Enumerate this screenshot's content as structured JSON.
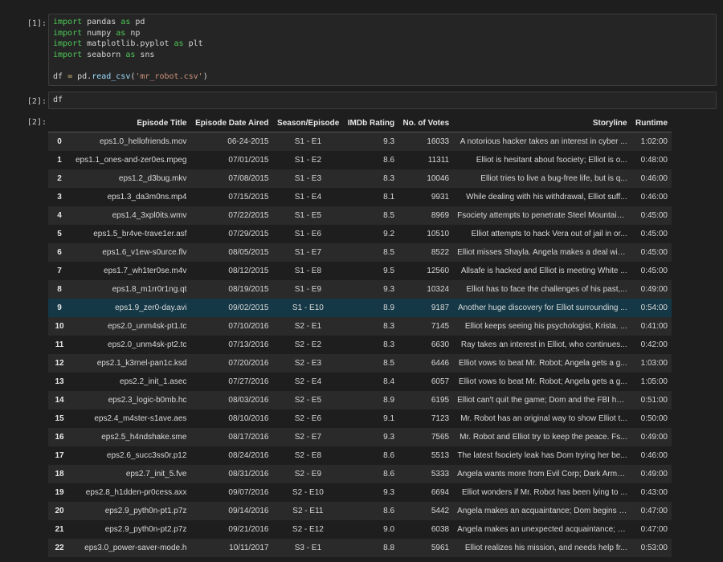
{
  "cells": [
    {
      "prompt": "[1]:",
      "code": [
        [
          {
            "t": "import",
            "c": "kw"
          },
          {
            "t": " pandas ",
            "c": "mod"
          },
          {
            "t": "as",
            "c": "kw"
          },
          {
            "t": " pd",
            "c": "id"
          }
        ],
        [
          {
            "t": "import",
            "c": "kw"
          },
          {
            "t": " numpy ",
            "c": "mod"
          },
          {
            "t": "as",
            "c": "kw"
          },
          {
            "t": " np",
            "c": "id"
          }
        ],
        [
          {
            "t": "import",
            "c": "kw"
          },
          {
            "t": " matplotlib.pyplot ",
            "c": "mod"
          },
          {
            "t": "as",
            "c": "kw"
          },
          {
            "t": " plt",
            "c": "id"
          }
        ],
        [
          {
            "t": "import",
            "c": "kw"
          },
          {
            "t": " seaborn ",
            "c": "mod"
          },
          {
            "t": "as",
            "c": "kw"
          },
          {
            "t": " sns",
            "c": "id"
          }
        ],
        [],
        [
          {
            "t": "df ",
            "c": "id"
          },
          {
            "t": "=",
            "c": "op"
          },
          {
            "t": " pd.",
            "c": "id"
          },
          {
            "t": "read_csv",
            "c": "fn"
          },
          {
            "t": "(",
            "c": "id"
          },
          {
            "t": "'mr_robot.csv'",
            "c": "str"
          },
          {
            "t": ")",
            "c": "id"
          }
        ]
      ]
    },
    {
      "prompt": "[2]:",
      "code": [
        [
          {
            "t": "df",
            "c": "id"
          }
        ]
      ]
    }
  ],
  "output": {
    "prompt": "[2]:",
    "columns": [
      "",
      "Episode Title",
      "Episode Date Aired",
      "Season/Episode",
      "IMDb Rating",
      "No. of Votes",
      "Storyline",
      "Runtime"
    ],
    "selected_row": 9,
    "rows": [
      [
        "0",
        "eps1.0_hellofriends.mov",
        "06-24-2015",
        "S1 - E1",
        "9.3",
        "16033",
        "A notorious hacker takes an interest in cyber ...",
        "1:02:00"
      ],
      [
        "1",
        "eps1.1_ones-and-zer0es.mpeg",
        "07/01/2015",
        "S1 - E2",
        "8.6",
        "11311",
        "Elliot is hesitant about fsociety; Elliot is o...",
        "0:48:00"
      ],
      [
        "2",
        "eps1.2_d3bug.mkv",
        "07/08/2015",
        "S1 - E3",
        "8.3",
        "10046",
        "Elliot tries to live a bug-free life, but is q...",
        "0:46:00"
      ],
      [
        "3",
        "eps1.3_da3m0ns.mp4",
        "07/15/2015",
        "S1 - E4",
        "8.1",
        "9931",
        "While dealing with his withdrawal, Elliot suff...",
        "0:46:00"
      ],
      [
        "4",
        "eps1.4_3xpl0its.wmv",
        "07/22/2015",
        "S1 - E5",
        "8.5",
        "8969",
        "Fsociety attempts to penetrate Steel Mountain,...",
        "0:45:00"
      ],
      [
        "5",
        "eps1.5_br4ve-trave1er.asf",
        "07/29/2015",
        "S1 - E6",
        "9.2",
        "10510",
        "Elliot attempts to hack Vera out of jail in or...",
        "0:45:00"
      ],
      [
        "6",
        "eps1.6_v1ew-s0urce.flv",
        "08/05/2015",
        "S1 - E7",
        "8.5",
        "8522",
        "Elliot misses Shayla. Angela makes a deal with...",
        "0:45:00"
      ],
      [
        "7",
        "eps1.7_wh1ter0se.m4v",
        "08/12/2015",
        "S1 - E8",
        "9.5",
        "12560",
        "Allsafe is hacked and Elliot is meeting White ...",
        "0:45:00"
      ],
      [
        "8",
        "eps1.8_m1rr0r1ng.qt",
        "08/19/2015",
        "S1 - E9",
        "9.3",
        "10324",
        "Elliot has to face the challenges of his past,...",
        "0:49:00"
      ],
      [
        "9",
        "eps1.9_zer0-day.avi",
        "09/02/2015",
        "S1 - E10",
        "8.9",
        "9187",
        "Another huge discovery for Elliot surrounding ...",
        "0:54:00"
      ],
      [
        "10",
        "eps2.0_unm4sk-pt1.tc",
        "07/10/2016",
        "S2 - E1",
        "8.3",
        "7145",
        "Elliot keeps seeing his psychologist, Krista. ...",
        "0:41:00"
      ],
      [
        "11",
        "eps2.0_unm4sk-pt2.tc",
        "07/13/2016",
        "S2 - E2",
        "8.3",
        "6630",
        "Ray takes an interest in Elliot, who continues...",
        "0:42:00"
      ],
      [
        "12",
        "eps2.1_k3rnel-pan1c.ksd",
        "07/20/2016",
        "S2 - E3",
        "8.5",
        "6446",
        "Elliot vows to beat Mr. Robot; Angela gets a g...",
        "1:03:00"
      ],
      [
        "13",
        "eps2.2_init_1.asec",
        "07/27/2016",
        "S2 - E4",
        "8.4",
        "6057",
        "Elliot vows to beat Mr. Robot; Angela gets a g...",
        "1:05:00"
      ],
      [
        "14",
        "eps2.3_logic-b0mb.hc",
        "08/03/2016",
        "S2 - E5",
        "8.9",
        "6195",
        "Elliot can't quit the game; Dom and the FBI he...",
        "0:51:00"
      ],
      [
        "15",
        "eps2.4_m4ster-s1ave.aes",
        "08/10/2016",
        "S2 - E6",
        "9.1",
        "7123",
        "Mr. Robot has an original way to show Elliot t...",
        "0:50:00"
      ],
      [
        "16",
        "eps2.5_h4ndshake.sme",
        "08/17/2016",
        "S2 - E7",
        "9.3",
        "7565",
        "Mr. Robot and Elliot try to keep the peace. Fs...",
        "0:49:00"
      ],
      [
        "17",
        "eps2.6_succ3ss0r.p12",
        "08/24/2016",
        "S2 - E8",
        "8.6",
        "5513",
        "The latest fsociety leak has Dom trying her be...",
        "0:46:00"
      ],
      [
        "18",
        "eps2.7_init_5.fve",
        "08/31/2016",
        "S2 - E9",
        "8.6",
        "5333",
        "Angela wants more from Evil Corp; Dark Army's ...",
        "0:49:00"
      ],
      [
        "19",
        "eps2.8_h1dden-pr0cess.axx",
        "09/07/2016",
        "S2 - E10",
        "9.3",
        "6694",
        "Elliot wonders if Mr. Robot has been lying to ...",
        "0:43:00"
      ],
      [
        "20",
        "eps2.9_pyth0n-pt1.p7z",
        "09/14/2016",
        "S2 - E11",
        "8.6",
        "5442",
        "Angela makes an acquaintance; Dom begins seein...",
        "0:47:00"
      ],
      [
        "21",
        "eps2.9_pyth0n-pt2.p7z",
        "09/21/2016",
        "S2 - E12",
        "9.0",
        "6038",
        "Angela makes an unexpected acquaintance; Darle...",
        "0:47:00"
      ],
      [
        "22",
        "eps3.0_power-saver-mode.h",
        "10/11/2017",
        "S3 - E1",
        "8.8",
        "5961",
        "Elliot realizes his mission, and needs help fr...",
        "0:53:00"
      ]
    ]
  },
  "colors": {
    "background": "#1e1e1e",
    "cell_bg": "#252526",
    "keyword": "#4ec955",
    "string": "#ce9178",
    "selected_row": "#143846"
  }
}
